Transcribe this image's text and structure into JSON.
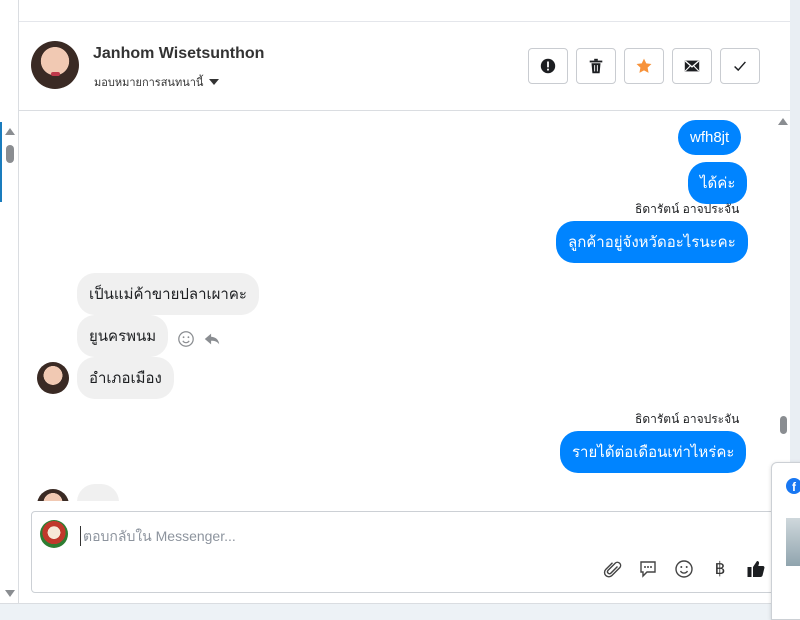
{
  "contact": {
    "name": "Janhom Wisetsunthon",
    "assign_label": "มอบหมายการสนทนานี้"
  },
  "actions": [
    {
      "name": "mark-spam",
      "icon": "exclamation-icon"
    },
    {
      "name": "delete",
      "icon": "trash-icon"
    },
    {
      "name": "star",
      "icon": "star-icon"
    },
    {
      "name": "mark-unread",
      "icon": "envelope-icon"
    },
    {
      "name": "mark-done",
      "icon": "check-icon"
    }
  ],
  "messages": {
    "out1": "wfh8jt",
    "out2": "ได้ค่ะ",
    "sender1": "ธิดารัตน์ อาจประจัน",
    "out3": "ลูกค้าอยู่จังหวัดอะไรนะคะ",
    "in1": "เป็นแม่ค้าขายปลาเผาคะ",
    "in2": "ยูนครพนม",
    "in3": "อำเภอเมือง",
    "sender2": "ธิดารัตน์ อาจประจัน",
    "out4": "รายได้ต่อเดือนเท่าไหร่คะ"
  },
  "composer": {
    "placeholder": "ตอบกลับใน Messenger..."
  },
  "composer_tools": [
    "paperclip-icon",
    "chat-bubble-icon",
    "emoji-icon",
    "baht-icon",
    "thumbs-up-icon"
  ],
  "baht_symbol": "฿",
  "fb_letter": "f",
  "colors": {
    "outgoing": "#0084ff",
    "incoming": "#f0f0f0",
    "star": "#f7923a"
  }
}
